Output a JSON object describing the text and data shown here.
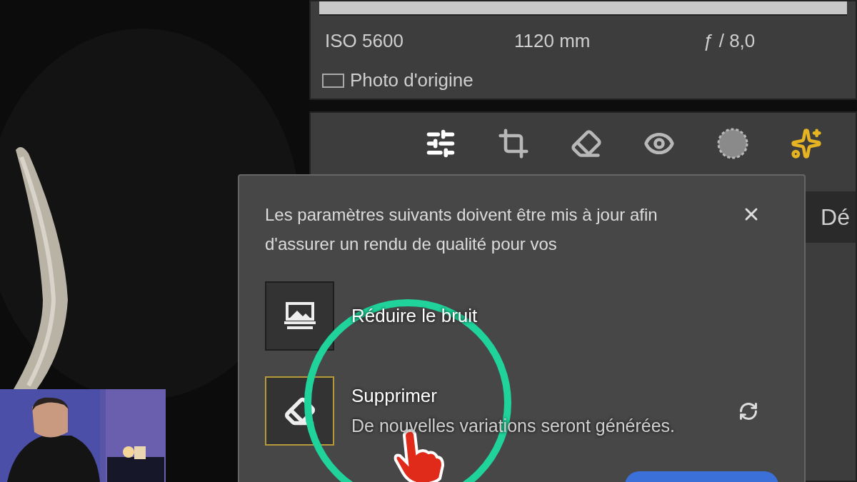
{
  "exif": {
    "iso": "ISO 5600",
    "focal": "1120 mm",
    "aperture": "ƒ / 8,0"
  },
  "original_photo": {
    "label": "Photo d'origine",
    "checked": false
  },
  "tools": [
    {
      "kind": "sliders",
      "selected": true
    },
    {
      "kind": "crop",
      "selected": false
    },
    {
      "kind": "eraser",
      "selected": false
    },
    {
      "kind": "redeye",
      "selected": false
    },
    {
      "kind": "mask",
      "selected": false
    },
    {
      "kind": "ai",
      "selected": false
    }
  ],
  "side_tab": "Dé",
  "dialog": {
    "message": "Les paramètres suivants doivent être mis à jour afin d'assurer un rendu de qualité pour vos",
    "items": [
      {
        "kind": "denoise",
        "title": "Réduire le bruit",
        "highlighted": false
      },
      {
        "kind": "remove",
        "title": "Supprimer",
        "subtitle": "De nouvelles variations seront générées.",
        "highlighted": true,
        "refresh": true
      }
    ]
  }
}
